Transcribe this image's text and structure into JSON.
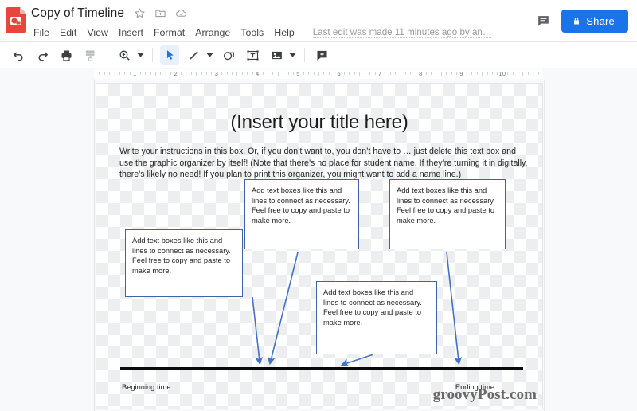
{
  "app": {
    "logo_icon": "google-slides-icon",
    "logo_color": "#e8453c"
  },
  "header": {
    "doc_title": "Copy of Timeline",
    "title_icons": [
      {
        "name": "star-icon",
        "glyph": "star"
      },
      {
        "name": "move-to-folder-icon",
        "glyph": "folder-move"
      },
      {
        "name": "cloud-saved-icon",
        "glyph": "cloud-check"
      }
    ],
    "menu": [
      {
        "label": "File"
      },
      {
        "label": "Edit"
      },
      {
        "label": "View"
      },
      {
        "label": "Insert"
      },
      {
        "label": "Format"
      },
      {
        "label": "Arrange"
      },
      {
        "label": "Tools"
      },
      {
        "label": "Help"
      }
    ],
    "edit_status": "Last edit was made 11 minutes ago by an…",
    "comment_icon": "comment-icon",
    "share": {
      "label": "Share",
      "icon": "lock-icon",
      "color": "#1a73e8"
    }
  },
  "toolbar": {
    "items": [
      {
        "name": "undo-button",
        "icon": "undo-icon",
        "state": "normal",
        "caret": false
      },
      {
        "name": "redo-button",
        "icon": "redo-icon",
        "state": "normal",
        "caret": false
      },
      {
        "name": "print-button",
        "icon": "print-icon",
        "state": "normal",
        "caret": false
      },
      {
        "name": "paint-format-button",
        "icon": "paint-roller-icon",
        "state": "disabled",
        "caret": false
      },
      {
        "name": "zoom-button",
        "icon": "magnifier-icon",
        "state": "normal",
        "caret": true
      },
      {
        "name": "select-tool-button",
        "icon": "cursor-arrow-icon",
        "state": "active",
        "caret": false
      },
      {
        "name": "line-tool-button",
        "icon": "line-icon",
        "state": "normal",
        "caret": true
      },
      {
        "name": "shape-tool-button",
        "icon": "shape-icon",
        "state": "normal",
        "caret": false
      },
      {
        "name": "textbox-tool-button",
        "icon": "text-box-icon",
        "state": "normal",
        "caret": false
      },
      {
        "name": "image-tool-button",
        "icon": "image-icon",
        "state": "normal",
        "caret": true
      },
      {
        "name": "comment-tool-button",
        "icon": "add-comment-icon",
        "state": "normal",
        "caret": false
      }
    ]
  },
  "ruler": {
    "numbers": [
      "1",
      "2",
      "3",
      "4",
      "5",
      "6",
      "7",
      "8",
      "9",
      "10"
    ]
  },
  "slide": {
    "title": "(Insert your title here)",
    "intro_paragraph": "Write your instructions in this box. Or, if you don’t want to, you don’t have to … just delete this text box and use the graphic organizer by itself! (Note that there’s no place for student name. If they’re turning it in digitally, there’s likely no need! If you plan to print this organizer, you might want to add a name line.)",
    "text_boxes": [
      {
        "name": "text-box-top-center",
        "text": "Add text boxes like this and lines to connect as necessary. Feel free to copy and paste to make more."
      },
      {
        "name": "text-box-top-right",
        "text": "Add text boxes like this and lines to connect as necessary. Feel free to copy and paste to make more."
      },
      {
        "name": "text-box-mid-left",
        "text": "Add text boxes like this and lines to connect as necessary. Feel free to copy and paste to make more."
      },
      {
        "name": "text-box-bottom-center",
        "text": "Add text boxes like this and lines to connect as necessary. Feel free to copy and paste to make more."
      }
    ],
    "timeline": {
      "begin_label": "Beginning time",
      "end_label": "Ending time",
      "line_color": "#0a0a0a",
      "arrow_color": "#3b65a8"
    },
    "watermark": "groovyPost.com"
  }
}
